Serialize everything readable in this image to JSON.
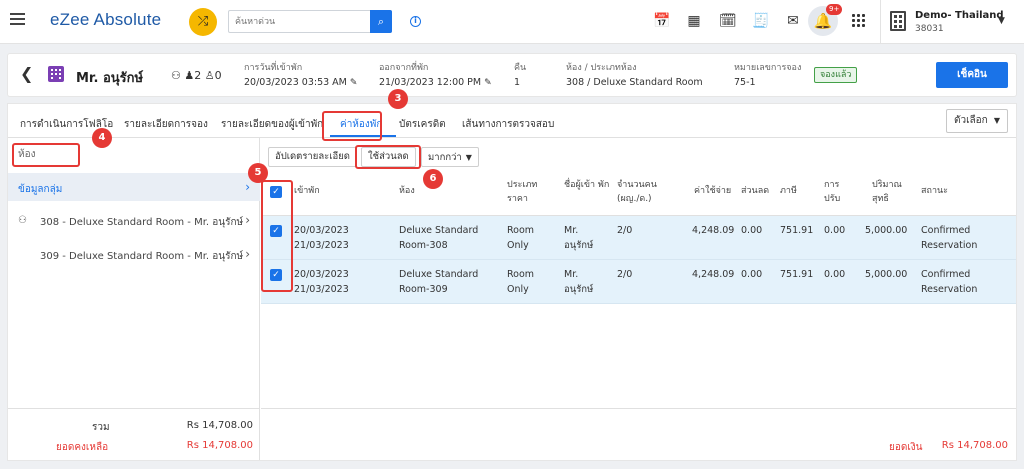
{
  "header": {
    "logo_text": "eZee Absolute",
    "search_placeholder": "ค้นหาด่วน",
    "notification_badge": "9+",
    "property_name": "Demo- Thailand",
    "property_code": "38031"
  },
  "guest": {
    "name": "Mr. อนุรักษ์",
    "adults": "2",
    "children": "0",
    "arrival_label": "การวันที่เข้าพัก",
    "arrival_value": "20/03/2023 03:53 AM",
    "departure_label": "ออกจากที่พัก",
    "departure_value": "21/03/2023 12:00 PM",
    "nights_label": "คืน",
    "nights_value": "1",
    "room_label": "ห้อง / ประเภทห้อง",
    "room_value": "308 / Deluxe Standard Room",
    "reservation_label": "หมายเลขการจอง",
    "reservation_value": "75-1",
    "status_badge": "จองแล้ว",
    "checkin_button": "เช็คอิน"
  },
  "tabs": [
    {
      "label": "การดำเนินการโฟลิโอ"
    },
    {
      "label": "รายละเอียดการจอง"
    },
    {
      "label": "รายละเอียดของผู้เข้าพัก"
    },
    {
      "label": "ค่าห้องพัก"
    },
    {
      "label": "บัตรเครดิต"
    },
    {
      "label": "เส้นทางการตรวจสอบ"
    }
  ],
  "options_button": "ตัวเลือก",
  "left": {
    "filter_label": "ห้อง",
    "group_label": "ข้อมูลกลุ่ม",
    "rooms": [
      {
        "label": "308 - Deluxe Standard Room - Mr. อนุรักษ์"
      },
      {
        "label": "309 - Deluxe Standard Room - Mr. อนุรักษ์"
      }
    ],
    "total_label": "รวม",
    "total_value": "Rs 14,708.00",
    "balance_label": "ยอดคงเหลือ",
    "balance_value": "Rs 14,708.00"
  },
  "toolbar": {
    "update_details": "อัปเดตรายละเอียด",
    "apply_discount": "ใช้ส่วนลด",
    "more": "มากกว่า"
  },
  "table": {
    "columns": [
      "เข้าพัก",
      "ห้อง",
      "ประเภท ราคา",
      "ชื่อผู้เข้า พัก",
      "จำนวนคน (ผญ./ด.)",
      "ค่าใช้จ่าย",
      "ส่วนลด",
      "ภาษี",
      "การ ปรับ",
      "ปริมาณ สุทธิ",
      "สถานะ"
    ],
    "rows": [
      {
        "date_from": "20/03/2023",
        "date_to": "21/03/2023",
        "room_1": "Deluxe Standard",
        "room_2": "Room-308",
        "rate_1": "Room",
        "rate_2": "Only",
        "guest_1": "Mr.",
        "guest_2": "อนุรักษ์",
        "pax": "2/0",
        "charge": "4,248.09",
        "discount": "0.00",
        "tax": "751.91",
        "adjust": "0.00",
        "net": "5,000.00",
        "status_1": "Confirmed",
        "status_2": "Reservation"
      },
      {
        "date_from": "20/03/2023",
        "date_to": "21/03/2023",
        "room_1": "Deluxe Standard",
        "room_2": "Room-309",
        "rate_1": "Room",
        "rate_2": "Only",
        "guest_1": "Mr.",
        "guest_2": "อนุรักษ์",
        "pax": "2/0",
        "charge": "4,248.09",
        "discount": "0.00",
        "tax": "751.91",
        "adjust": "0.00",
        "net": "5,000.00",
        "status_1": "Confirmed",
        "status_2": "Reservation"
      }
    ],
    "balance_label": "ยอดเงิน",
    "balance_value": "Rs 14,708.00"
  },
  "annotations": {
    "n3": "3",
    "n4": "4",
    "n5": "5",
    "n6": "6"
  },
  "colors": {
    "accent": "#1a73e8",
    "annotation": "#e53935",
    "row_selected": "#e4f2fb",
    "confirmed": "#43a047"
  }
}
